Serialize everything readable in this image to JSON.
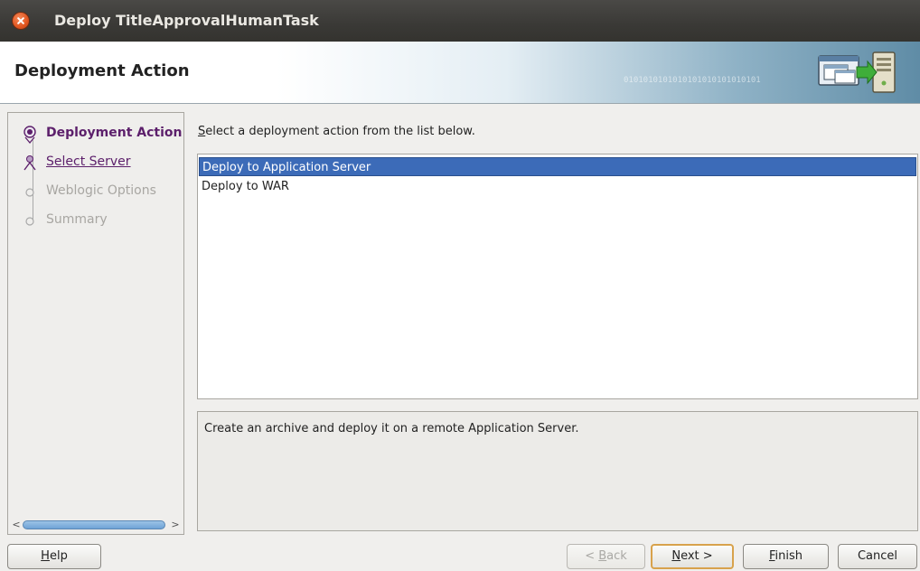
{
  "window": {
    "title": "Deploy TitleApprovalHumanTask"
  },
  "header": {
    "title": "Deployment Action",
    "binary_text": "0101010101010101010101010101"
  },
  "nav": {
    "items": [
      {
        "label": "Deployment Action",
        "state": "current"
      },
      {
        "label": "Select Server",
        "state": "link"
      },
      {
        "label": "Weblogic Options",
        "state": "disabled"
      },
      {
        "label": "Summary",
        "state": "disabled"
      }
    ],
    "scroll_left": "<",
    "scroll_right": ">"
  },
  "content": {
    "instruction_mnemonic": "S",
    "instruction_rest": "elect a deployment action from the list below.",
    "actions": [
      {
        "label": "Deploy to Application Server",
        "selected": true
      },
      {
        "label": "Deploy to WAR",
        "selected": false
      }
    ],
    "description": "Create an archive and deploy it on a remote Application Server."
  },
  "buttons": {
    "help": {
      "mn": "H",
      "rest": "elp"
    },
    "back": {
      "pre": "< ",
      "mn": "B",
      "rest": "ack"
    },
    "next": {
      "mn": "N",
      "rest": "ext >"
    },
    "finish": {
      "mn": "F",
      "rest": "inish"
    },
    "cancel": {
      "label": "Cancel"
    }
  },
  "colors": {
    "selection": "#3c6bb8",
    "nav_link": "#5c1f6b",
    "titlebar": "#3c3b37",
    "close": "#e2551f"
  }
}
